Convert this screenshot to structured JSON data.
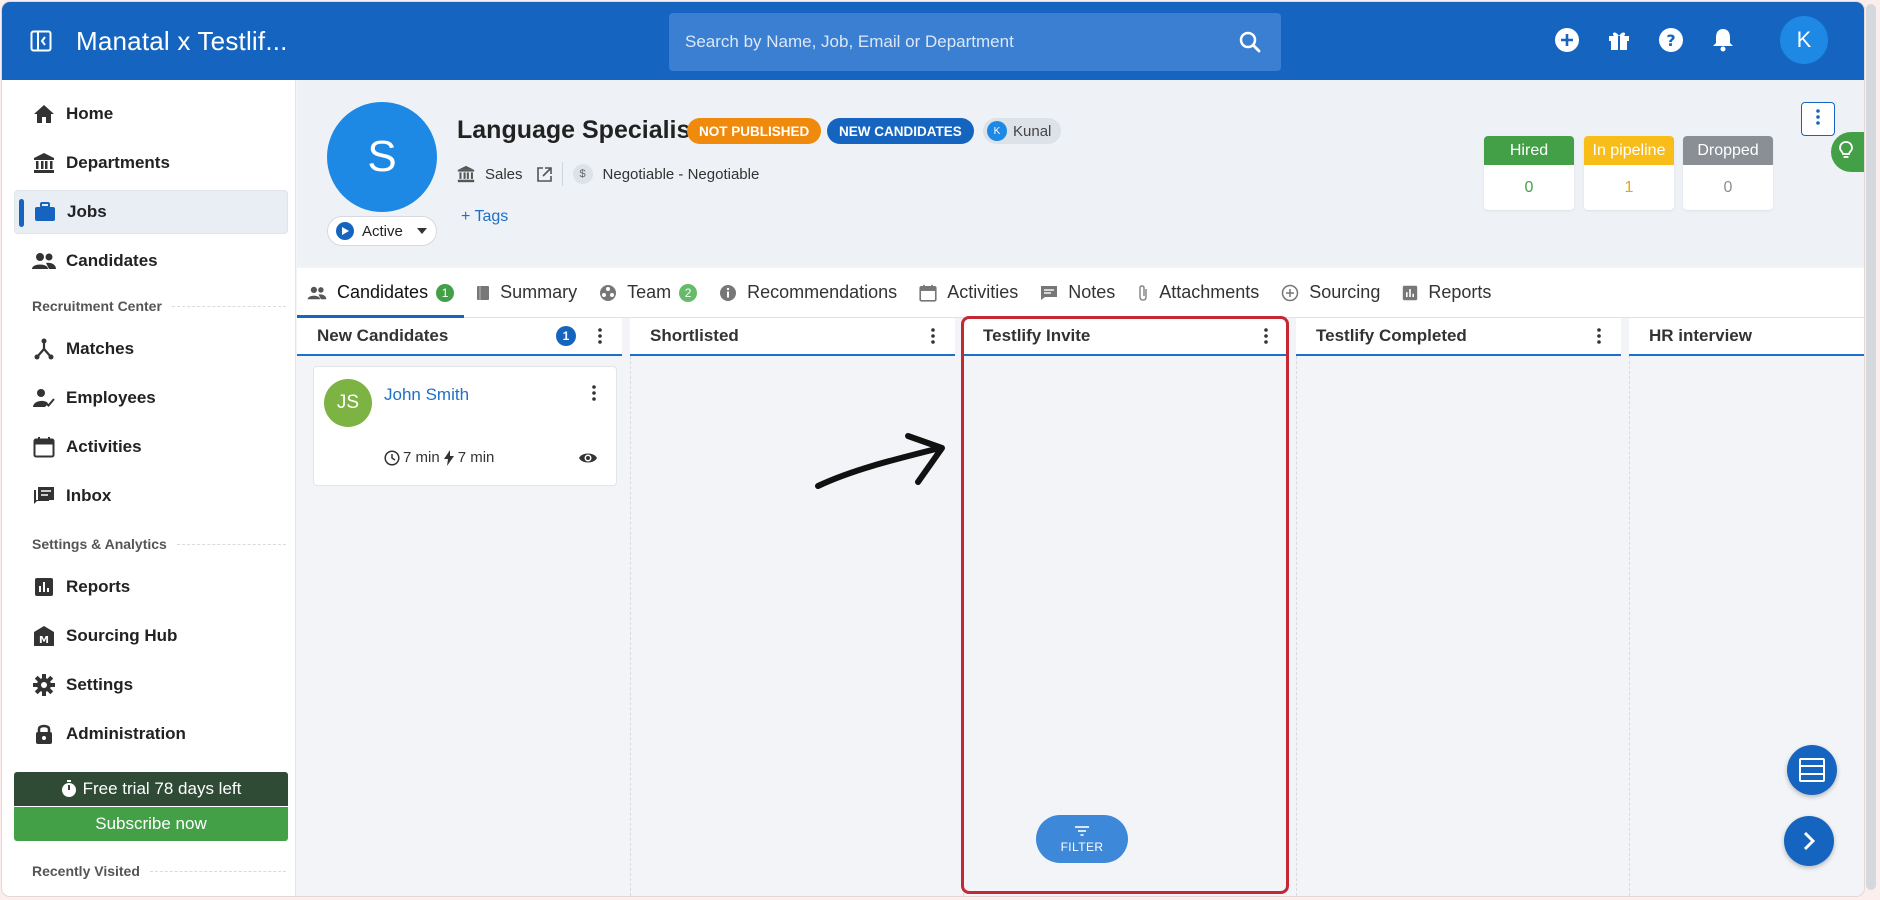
{
  "app": {
    "title": "Manatal x Testlif...",
    "search_placeholder": "Search by Name, Job, Email or Department",
    "user_initial": "K",
    "colors": {
      "primary": "#1565c0",
      "success": "#43a047",
      "warning": "#f08a0c",
      "highlight": "#c62833"
    }
  },
  "sidebar": {
    "items_top": [
      {
        "label": "Home",
        "icon": "home-icon"
      },
      {
        "label": "Departments",
        "icon": "bank-icon"
      },
      {
        "label": "Jobs",
        "icon": "briefcase-icon",
        "active": true
      },
      {
        "label": "Candidates",
        "icon": "people-icon"
      }
    ],
    "section_recruitment": "Recruitment Center",
    "items_recruitment": [
      {
        "label": "Matches",
        "icon": "matches-icon"
      },
      {
        "label": "Employees",
        "icon": "employee-icon"
      },
      {
        "label": "Activities",
        "icon": "calendar-icon"
      },
      {
        "label": "Inbox",
        "icon": "inbox-icon"
      }
    ],
    "section_settings": "Settings & Analytics",
    "items_settings": [
      {
        "label": "Reports",
        "icon": "bar-chart-icon"
      },
      {
        "label": "Sourcing Hub",
        "icon": "sourcing-hub-icon"
      },
      {
        "label": "Settings",
        "icon": "gear-icon"
      },
      {
        "label": "Administration",
        "icon": "lock-icon"
      }
    ],
    "trial_text": "Free trial 78 days left",
    "subscribe_label": "Subscribe now",
    "recently_visited": "Recently Visited"
  },
  "job": {
    "avatar_letter": "S",
    "status": "Active",
    "title": "Language Specialist",
    "badge_published": "NOT PUBLISHED",
    "badge_new": "NEW CANDIDATES",
    "owner_initial": "K",
    "owner_name": "Kunal",
    "department": "Sales",
    "salary": "Negotiable - Negotiable",
    "tags_label": "+ Tags",
    "stats": [
      {
        "label": "Hired",
        "value": "0",
        "head_color": "#43a047",
        "value_color": "#43a047"
      },
      {
        "label": "In pipeline",
        "value": "1",
        "head_color": "#f9bd1a",
        "value_color": "#f0a500"
      },
      {
        "label": "Dropped",
        "value": "0",
        "head_color": "#8a8f95",
        "value_color": "#8a8f95"
      }
    ]
  },
  "tabs": [
    {
      "label": "Candidates",
      "count": "1",
      "icon": "people-icon",
      "active": true
    },
    {
      "label": "Summary",
      "icon": "book-icon"
    },
    {
      "label": "Team",
      "count": "2",
      "icon": "team-icon"
    },
    {
      "label": "Recommendations",
      "icon": "info-icon"
    },
    {
      "label": "Activities",
      "icon": "calendar-icon"
    },
    {
      "label": "Notes",
      "icon": "comment-icon"
    },
    {
      "label": "Attachments",
      "icon": "paperclip-icon"
    },
    {
      "label": "Sourcing",
      "icon": "plus-circle-icon"
    },
    {
      "label": "Reports",
      "icon": "bar-chart-icon"
    }
  ],
  "board": {
    "columns": [
      {
        "name": "New Candidates",
        "count": "1"
      },
      {
        "name": "Shortlisted"
      },
      {
        "name": "Testlify Invite"
      },
      {
        "name": "Testlify Completed"
      },
      {
        "name": "HR interview"
      }
    ],
    "card": {
      "initials": "JS",
      "name": "John Smith",
      "time1": "7 min",
      "time2": "7 min"
    },
    "filter_label": "FILTER"
  }
}
